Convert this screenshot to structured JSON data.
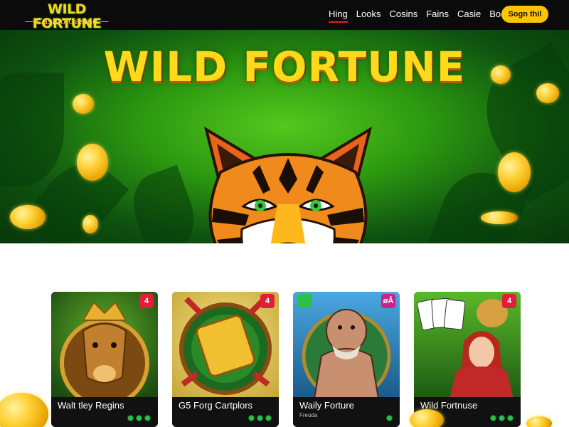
{
  "header": {
    "logo_title": "WILD FORTUNE",
    "logo_subtitle": "— Casino Casino —",
    "nav": [
      {
        "label": "Hing",
        "active": true
      },
      {
        "label": "Looks",
        "active": false
      },
      {
        "label": "Cosins",
        "active": false
      },
      {
        "label": "Fains",
        "active": false
      },
      {
        "label": "Casie",
        "active": false
      },
      {
        "label": "Boot",
        "active": false
      }
    ],
    "signup_label": "Sogn thil"
  },
  "hero": {
    "title": "WILD FORTUNE",
    "image": "tiger-face"
  },
  "games": [
    {
      "title": "Walt tley Regins",
      "subtitle": "",
      "image": "golden-bull-king",
      "badge": "4",
      "badge_color": "#e0203a"
    },
    {
      "title": "G5 Forg Cartplors",
      "subtitle": "",
      "image": "lucky-numbers-reel",
      "badge": "4",
      "badge_color": "#e0203a"
    },
    {
      "title": "Waily Forture",
      "subtitle": "Freuda",
      "image": "ogre-warrior",
      "badge": "øÅ",
      "badge_color": "#d0208a"
    },
    {
      "title": "Wild Fortnuse",
      "subtitle": "",
      "image": "queen-playing-cards",
      "badge": "4",
      "badge_color": "#e0203a"
    }
  ],
  "colors": {
    "nav_bg": "#0b0b0b",
    "accent_yellow": "#ffc400",
    "active_underline": "#e0201a",
    "hero_green": "#2d9a10"
  }
}
